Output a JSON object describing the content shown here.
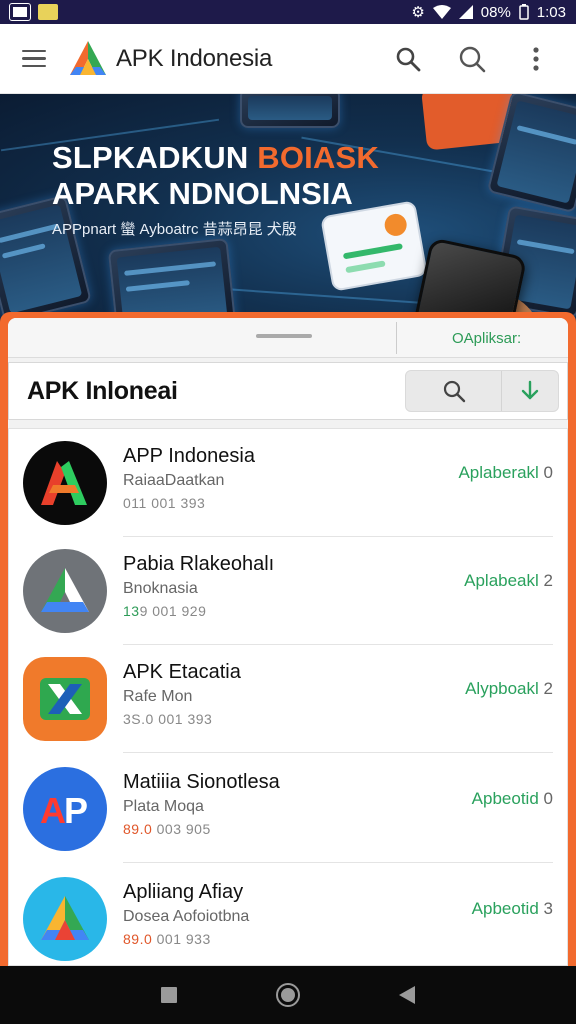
{
  "status_bar": {
    "battery": "08%",
    "time": "1:03",
    "icons": [
      "image-icon",
      "notification-icon",
      "gear-icon",
      "wifi-icon",
      "signal-icon"
    ]
  },
  "app_bar": {
    "title": "APK Indonesia",
    "icons": [
      "menu-icon",
      "apk-logo",
      "search-icon",
      "search-icon",
      "more-vert-icon"
    ]
  },
  "banner": {
    "headline_part1": "SLPKADKUN",
    "headline_part2": "BOIASK",
    "headline_line2": "APARK NDNOLNSIA",
    "subtitle": "APPpnart 蠻 Ayboatrc 昔蒜昂昆 犬殷"
  },
  "sheet": {
    "tab_label": "OApliksar:",
    "search_title": "APK Inloneai",
    "search_icon": "search-icon",
    "download_icon": "download-icon"
  },
  "apps": [
    {
      "name": "APP Indonesia",
      "subtitle": "RaiaaDaatkan",
      "meta": "011 001 393",
      "meta_highlight": "",
      "action": "Aplaberakl",
      "count": "0",
      "icon": "apk-red-green-logo"
    },
    {
      "name": "Pabia Rlakeohalı",
      "subtitle": "Bnoknasia",
      "meta": "9 001 929",
      "meta_highlight": "13",
      "action": "Aplabeakl",
      "count": "2",
      "icon": "gray-triangle-logo"
    },
    {
      "name": "APK Etacatia",
      "subtitle": "Rafe Mon",
      "meta": "3S.0 001 393",
      "meta_highlight": "",
      "action": "Alypboakl",
      "count": "2",
      "icon": "orange-x-logo"
    },
    {
      "name": "Matiiia Sionotlesa",
      "subtitle": "Plata Moqa",
      "meta": "003 905",
      "meta_highlight": "89.0",
      "action": "Apbeotid",
      "count": "0",
      "icon": "blue-ap-logo"
    },
    {
      "name": "Apliiang Afiay",
      "subtitle": "Dosea Aofoiotbna",
      "meta": "001 933",
      "meta_highlight": "89.0",
      "action": "Apbeotid",
      "count": "3",
      "icon": "light-blue-triangle-logo"
    }
  ],
  "nav_bar": {
    "icons": [
      "recents-icon",
      "home-icon",
      "back-icon"
    ]
  },
  "colors": {
    "status_bar": "#1e1a4a",
    "accent_orange": "#f26a2e",
    "accent_green": "#2aa15d"
  }
}
